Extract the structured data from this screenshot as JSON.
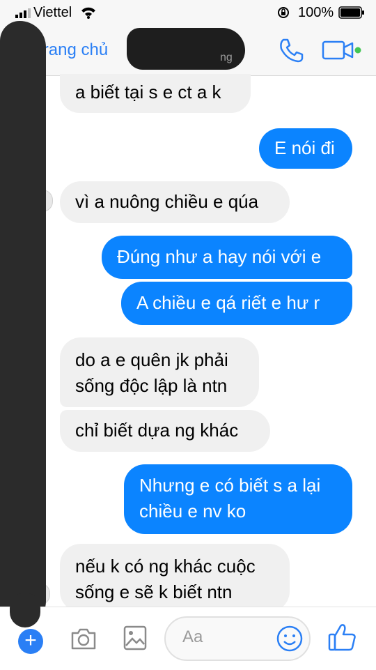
{
  "status_bar": {
    "carrier": "Viettel",
    "battery_percent": "100%"
  },
  "header": {
    "back_label": "Trang chủ",
    "contact_name": "",
    "contact_subtitle": "ng"
  },
  "messages": [
    {
      "from": "received",
      "text": "a biết tại s e ct a k"
    },
    {
      "from": "sent",
      "text": "E nói đi"
    },
    {
      "from": "received",
      "text": "vì a nuông chiều e qúa"
    },
    {
      "from": "sent",
      "text": "Đúng như a hay nói với e"
    },
    {
      "from": "sent",
      "text": "A chiều e qá riết e hư r"
    },
    {
      "from": "received",
      "lines": [
        "do a e quên jk phải",
        "sống độc lập là ntn"
      ]
    },
    {
      "from": "received",
      "text": "chỉ biết dựa ng khác"
    },
    {
      "from": "sent",
      "lines": [
        "Nhưng e có biết s a lại",
        "chiều e nv ko"
      ]
    },
    {
      "from": "received",
      "lines": [
        "nếu k có ng khác cuộc",
        "sống e sẽ k biết ntn"
      ]
    }
  ],
  "composer": {
    "placeholder": "Aa",
    "plus_label": "+"
  },
  "colors": {
    "accent": "#2a7ff5",
    "sent_bubble": "#0b84ff",
    "received_bubble": "#f0f0f0",
    "online_dot": "#44c655"
  },
  "icons": [
    "signal-icon",
    "wifi-icon",
    "rotation-lock-icon",
    "battery-icon",
    "phone-icon",
    "video-camera-icon",
    "camera-icon",
    "photo-icon",
    "emoji-icon",
    "thumbs-up-icon"
  ]
}
